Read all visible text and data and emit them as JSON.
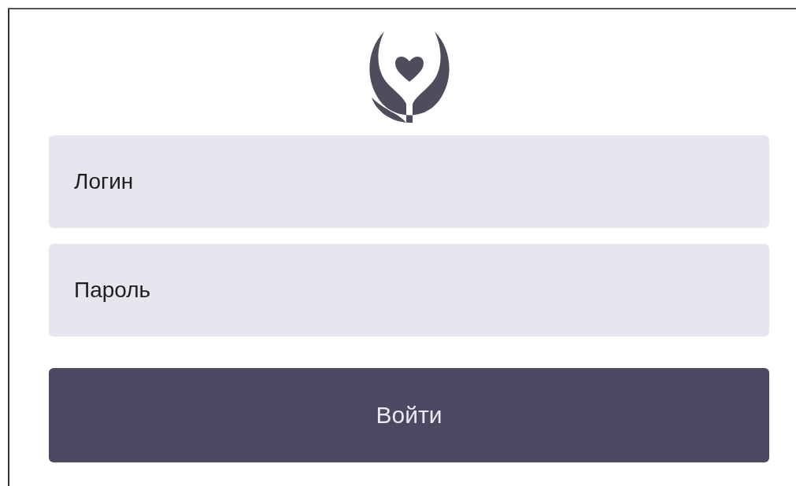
{
  "login_form": {
    "login_field": {
      "placeholder": "Логин"
    },
    "password_field": {
      "placeholder": "Пароль"
    },
    "submit_button": {
      "label": "Войти"
    }
  }
}
